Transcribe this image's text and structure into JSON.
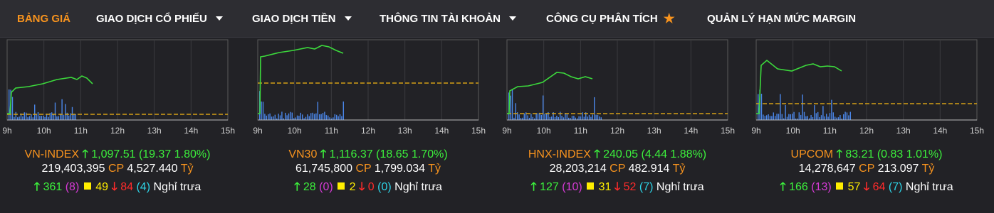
{
  "nav": {
    "items": [
      {
        "label": "BẢNG GIÁ",
        "active": true
      },
      {
        "label": "GIAO DỊCH CỔ PHIẾU",
        "dropdown": true
      },
      {
        "label": "GIAO DỊCH TIỀN",
        "dropdown": true
      },
      {
        "label": "THÔNG TIN TÀI KHOẢN",
        "dropdown": true
      },
      {
        "label": "CÔNG CỤ PHÂN TÍCH",
        "icon": "star-icon"
      },
      {
        "label": "QUẢN LÝ HẠN MỨC MARGIN"
      }
    ],
    "colors": {
      "active": "#f7931e",
      "text": "#ffffff",
      "star": "#f7931e"
    }
  },
  "time_axis": [
    "9h",
    "10h",
    "11h",
    "12h",
    "13h",
    "14h",
    "15h"
  ],
  "colors": {
    "price_line": "#3cd93c",
    "reference_line": "#d4a017",
    "volume_bars": "#4a86e8",
    "up": "#3cf03c",
    "down": "#ff2b2b",
    "ceiling": "#d63ad6",
    "unchanged": "#ffee00",
    "floor": "#2dd3e6",
    "index_name": "#f7931e"
  },
  "indices": [
    {
      "name": "VN-INDEX",
      "value": "1,097.51",
      "change": "(19.37 1.80%)",
      "volume": "219,403,395",
      "cp_label": "CP",
      "value_traded": "4,527.440",
      "unit": "Tỷ",
      "advances": "361",
      "ceiling": "(8)",
      "unchanged": "49",
      "declines": "84",
      "floor": "(4)",
      "status": "Nghỉ trưa"
    },
    {
      "name": "VN30",
      "value": "1,116.37",
      "change": "(18.65 1.70%)",
      "volume": "61,745,800",
      "cp_label": "CP",
      "value_traded": "1,799.034",
      "unit": "Tỷ",
      "advances": "28",
      "ceiling": "(0)",
      "unchanged": "2",
      "declines": "0",
      "floor": "(0)",
      "status": "Nghỉ trưa"
    },
    {
      "name": "HNX-INDEX",
      "value": "240.05",
      "change": "(4.44 1.88%)",
      "volume": "28,203,214",
      "cp_label": "CP",
      "value_traded": "482.914",
      "unit": "Tỷ",
      "advances": "127",
      "ceiling": "(10)",
      "unchanged": "31",
      "declines": "52",
      "floor": "(7)",
      "status": "Nghỉ trưa"
    },
    {
      "name": "UPCOM",
      "value": "83.21",
      "change": "(0.83 1.01%)",
      "volume": "14,278,647",
      "cp_label": "CP",
      "value_traded": "213.097",
      "unit": "Tỷ",
      "advances": "166",
      "ceiling": "(13)",
      "unchanged": "57",
      "declines": "64",
      "floor": "(7)",
      "status": "Nghỉ trưa"
    }
  ]
}
